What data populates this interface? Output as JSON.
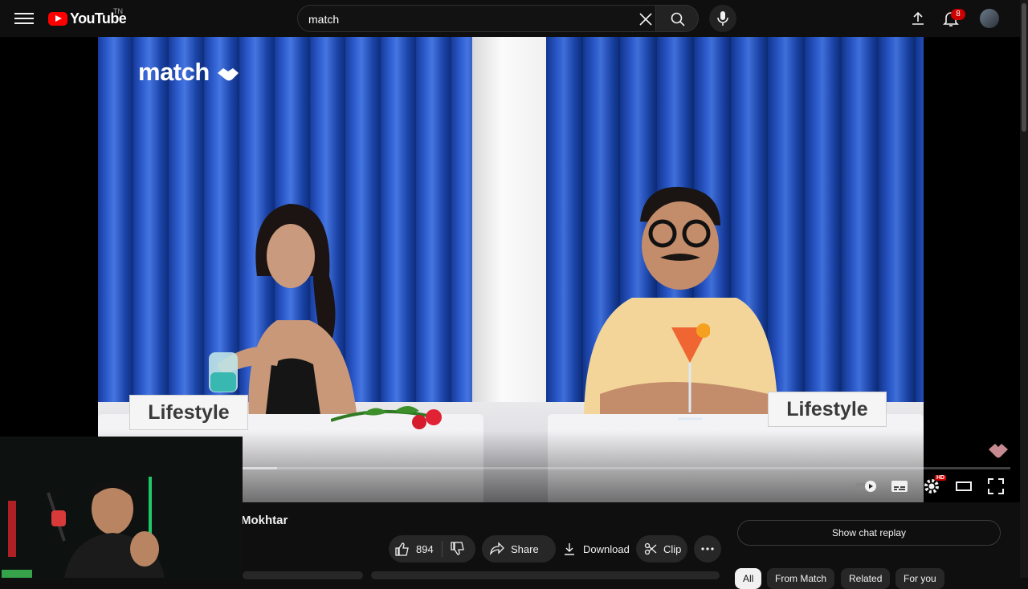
{
  "app": {
    "logo_text": "YouTube",
    "country_code": "TN"
  },
  "search": {
    "query": "match"
  },
  "notifications": {
    "count": "8"
  },
  "video": {
    "brand_overlay": "match",
    "plate_left": "Lifestyle",
    "plate_right": "Lifestyle",
    "progress_played_fraction": 0.0,
    "progress_loaded_fraction": 0.047,
    "hd_badge": "HD"
  },
  "below": {
    "title_fragment": "Mokhtar",
    "like_count": "894",
    "share_label": "Share",
    "download_label": "Download",
    "clip_label": "Clip",
    "chat_replay_label": "Show chat replay"
  },
  "chips": [
    {
      "label": "All",
      "active": true
    },
    {
      "label": "From Match",
      "active": false
    },
    {
      "label": "Related",
      "active": false
    },
    {
      "label": "For you",
      "active": false
    }
  ],
  "colors": {
    "brand_red": "#ff0000",
    "background": "#0f0f0f",
    "pill": "#272727",
    "curtain_blue": "#2f5ed0"
  }
}
